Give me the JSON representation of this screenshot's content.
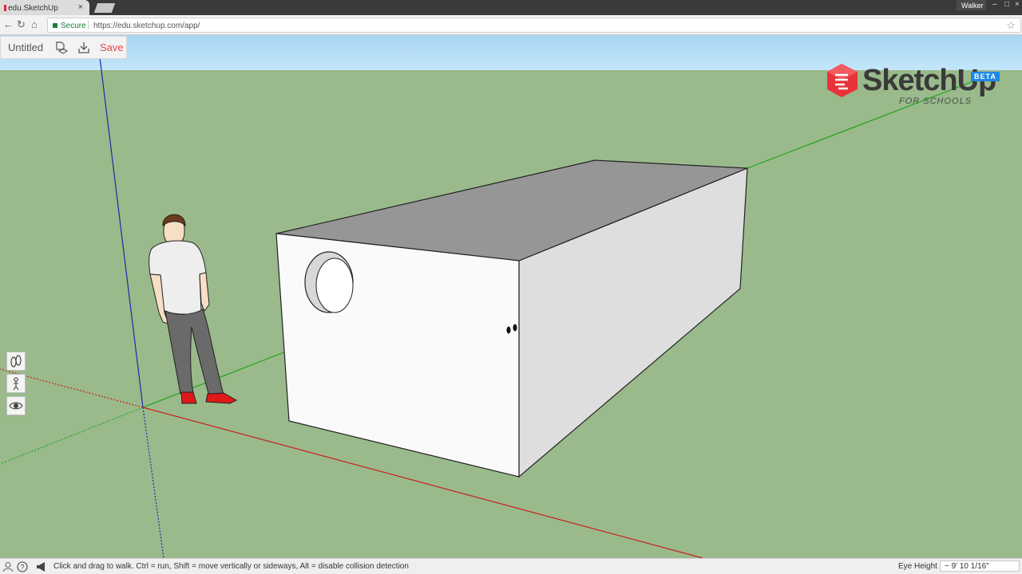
{
  "browser": {
    "tab_title": "edu.SketchUp",
    "tab_close": "×",
    "user_label": "Walker",
    "window_controls": [
      "–",
      "□",
      "×"
    ],
    "secure_label": "Secure",
    "url": "https://edu.sketchup.com/app/"
  },
  "document": {
    "title": "Untitled",
    "save_label": "Save"
  },
  "logo": {
    "word": "SketchUp",
    "badge": "BETA",
    "subtitle": "FOR SCHOOLS"
  },
  "tools": {
    "icons": [
      "walk-icon",
      "position-camera-icon",
      "look-around-icon"
    ]
  },
  "status": {
    "hint": "Click and drag to walk. Ctrl = run, Shift = move vertically or sideways, Alt = disable collision detection",
    "eye_height_label": "Eye Height",
    "eye_height_value": "~ 9' 10 1/16\""
  },
  "colors": {
    "ground": "#9aba8b",
    "sky": "#b6def6",
    "x_axis": "#c8201e",
    "y_axis": "#1da41d",
    "z_axis": "#1c2aa8",
    "box_top": "#969696",
    "box_front": "#fafafa",
    "box_side": "#dedede",
    "save_red": "#e34b4b"
  }
}
